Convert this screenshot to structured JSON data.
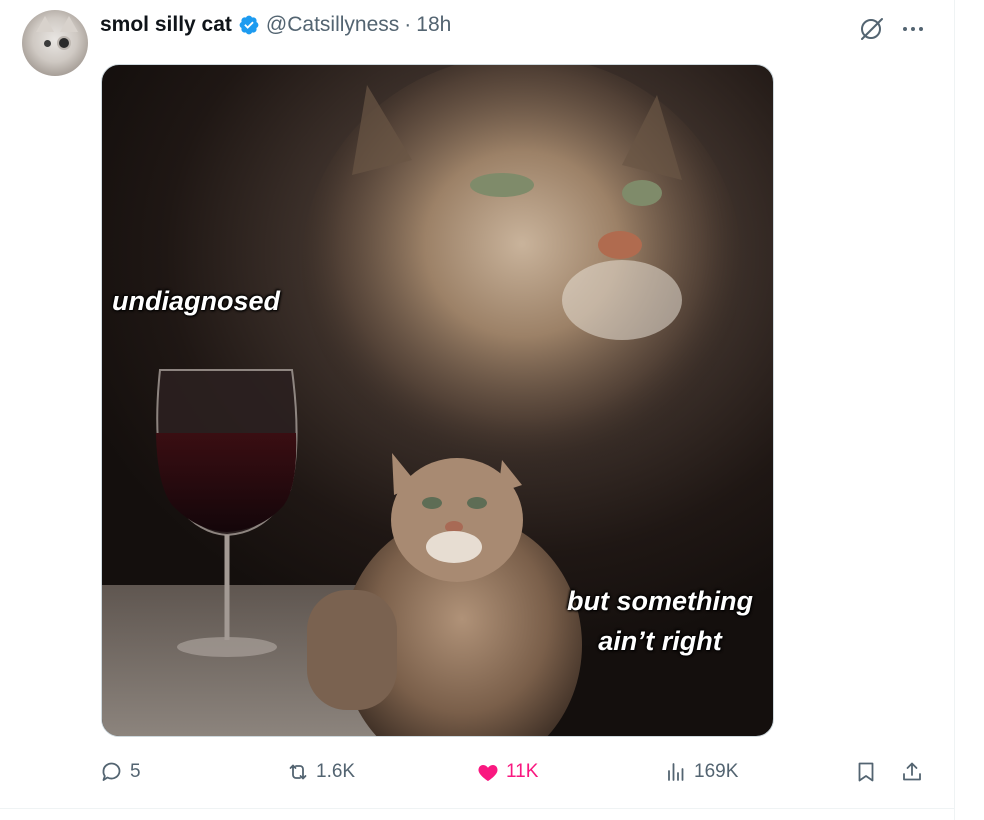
{
  "tweet": {
    "author": {
      "display_name": "smol silly cat",
      "handle": "@Catsillyness",
      "separator": "·",
      "time": "18h",
      "verified": true
    },
    "media": {
      "caption_top": "undiagnosed",
      "caption_bottom": "but something ain’t right",
      "subject": "cat-meme-with-wine-glass"
    },
    "actions": {
      "replies": "5",
      "reposts": "1.6K",
      "likes": "11K",
      "views": "169K"
    }
  },
  "colors": {
    "text_primary": "#0f1419",
    "text_secondary": "#536471",
    "verified_blue": "#1d9bf0",
    "like_pink": "#f91880"
  },
  "icons": [
    "grok-icon",
    "more-icon",
    "reply-icon",
    "repost-icon",
    "like-icon",
    "views-icon",
    "bookmark-icon",
    "share-icon"
  ]
}
